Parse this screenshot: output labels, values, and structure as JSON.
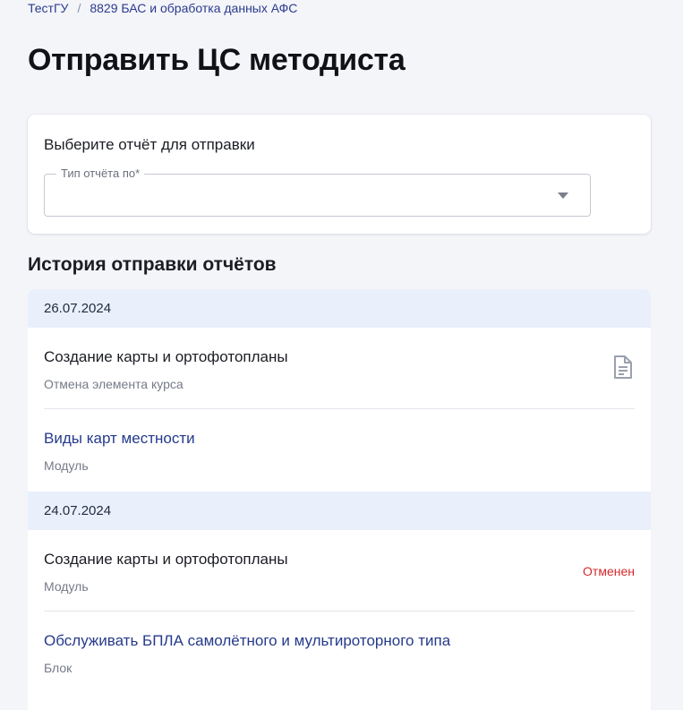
{
  "breadcrumb": {
    "items": [
      "ТестГУ",
      "8829 БАС и обработка данных АФС"
    ],
    "separator": "/"
  },
  "page_title": "Отправить ЦС методиста",
  "select_card": {
    "label": "Выберите отчёт для отправки",
    "field_legend": "Тип отчёта по*",
    "field_value": ""
  },
  "history": {
    "title": "История отправки отчётов",
    "groups": [
      {
        "date": "26.07.2024",
        "items": [
          {
            "title": "Создание карты и ортофотопланы",
            "subtitle": "Отмена элемента курса",
            "icon": "document-icon"
          },
          {
            "title": "Виды карт местности",
            "subtitle": "Модуль"
          }
        ]
      },
      {
        "date": "24.07.2024",
        "items": [
          {
            "title": "Создание карты и ортофотопланы",
            "subtitle": "Модуль",
            "status": "Отменен"
          },
          {
            "title": "Обслуживать БПЛА самолётного и мультироторного типа",
            "subtitle": "Блок"
          }
        ]
      }
    ]
  },
  "colors": {
    "background": "#f4f5f9",
    "link": "#253a8c",
    "date_header_bg": "#e9f0fc",
    "status_cancelled": "#d7282b"
  }
}
